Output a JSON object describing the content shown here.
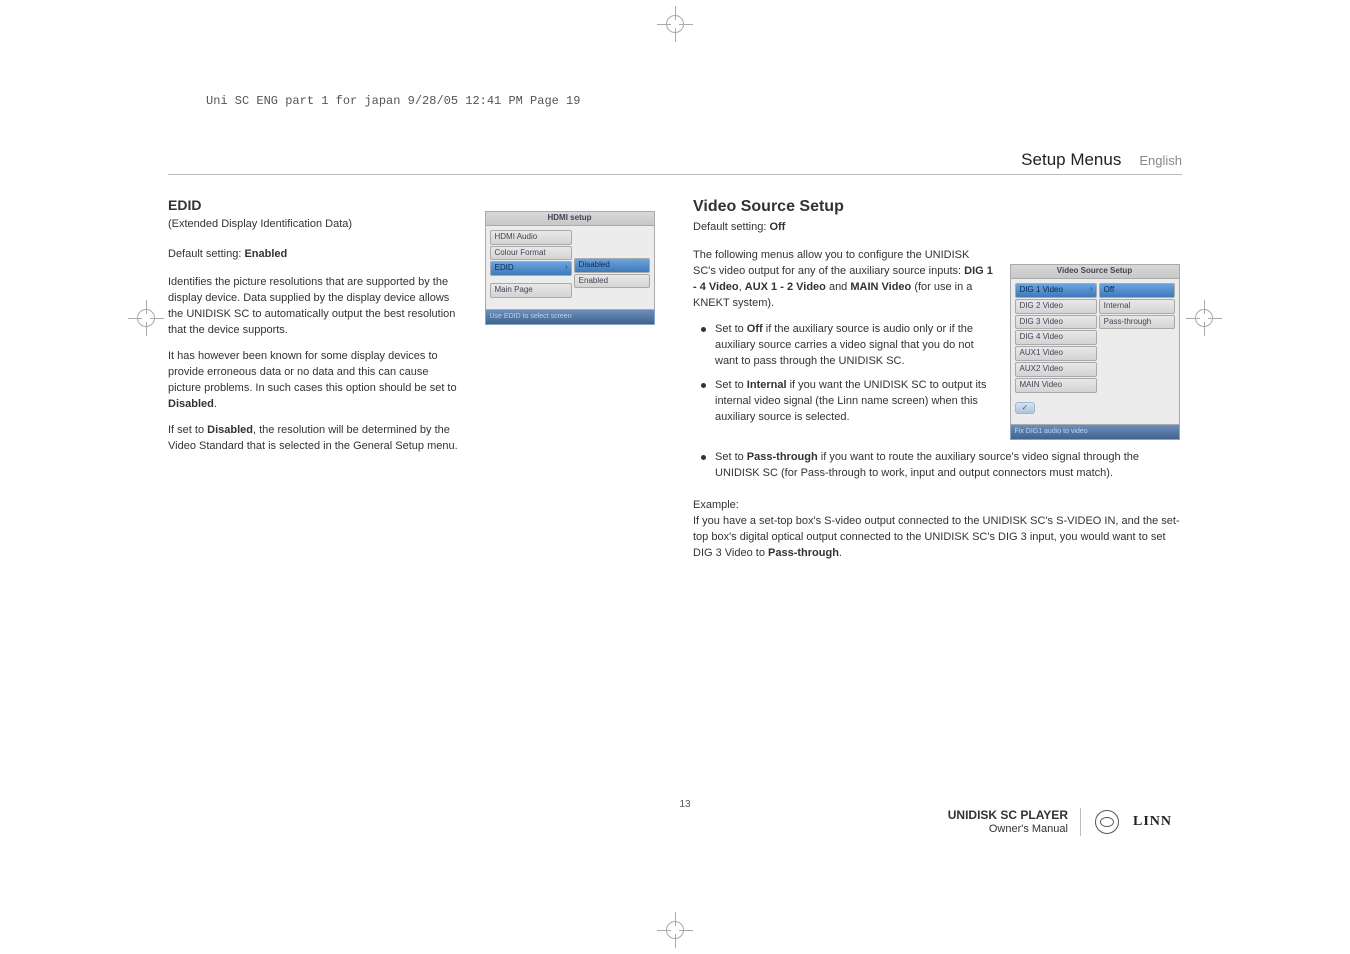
{
  "slug": "Uni SC ENG part 1 for japan  9/28/05  12:41 PM  Page 19",
  "header": {
    "title": "Setup Menus",
    "lang": "English"
  },
  "left": {
    "heading": "EDID",
    "subtitle": "(Extended Display Identification Data)",
    "default": "Default setting: ",
    "default_val": "Enabled",
    "p1": "Identifies the picture resolutions that are supported by the display device. Data supplied by the display device allows the UNIDISK SC to automatically output the best resolution that the device supports.",
    "p2": "It has however been known for some display devices to provide erroneous data or no data and this can cause picture problems. In such cases this option should be set to ",
    "p2b": "Disabled",
    "p2tail": ".",
    "p3a": "If set to ",
    "p3b": "Disabled",
    "p3c": ", the resolution will be determined by the Video Standard that is selected in the General Setup menu."
  },
  "fig1": {
    "title": "HDMI setup",
    "rows": [
      "HDMI Audio",
      "Colour Format",
      "EDID",
      "Main Page"
    ],
    "sel_index": 2,
    "opts": [
      "Disabled",
      "Enabled"
    ],
    "opt_sel": 0,
    "caption": "Use EDID to select screen"
  },
  "right": {
    "heading": "Video Source Setup",
    "default": "Default setting: ",
    "default_val": "Off",
    "p1a": "The following menus allow you to configure the UNIDISK SC's video output for any of the auxiliary source inputs: ",
    "p1b1": "DIG 1 - 4 Video",
    "p1s1": ", ",
    "p1b2": "AUX 1 - 2 Video",
    "p1s2": " and ",
    "p1b3": "MAIN Video",
    "p1c": " (for use in a KNEKT system).",
    "b1a": "Set to ",
    "b1b": "Off",
    "b1c": " if the auxiliary source is audio only or if the auxiliary source carries a video signal that you do not want to pass through the UNIDISK SC.",
    "b2a": "Set to ",
    "b2b": "Internal",
    "b2c": " if you want the UNIDISK SC to output its internal video signal (the Linn name screen) when this auxiliary source is selected.",
    "b3a": "Set to ",
    "b3b": "Pass-through",
    "b3c": "  if you want to route the auxiliary source's video signal through the UNIDISK SC (for Pass-through to work, input and output connectors must match).",
    "example_h": "Example:",
    "example_p": "If you have a set-top box's S-video output connected to the UNIDISK SC's S-VIDEO IN, and the set-top box's digital optical output connected to the UNIDISK SC's DIG 3 input, you would want to set DIG 3 Video to ",
    "example_b": "Pass-through",
    "example_t": "."
  },
  "fig2": {
    "title": "Video Source Setup",
    "rows": [
      "DIG 1 Video",
      "DIG 2 Video",
      "DIG 3 Video",
      "DIG 4 Video",
      "AUX1 Video",
      "AUX2 Video",
      "MAIN Video"
    ],
    "sel_index": 0,
    "opts": [
      "Off",
      "Internal",
      "Pass-through"
    ],
    "opt_sel": 0,
    "tick": "✓",
    "caption": "Fix DIG1 audio to video"
  },
  "chart_data": {
    "type": "table",
    "title": "Setup menu figures depicted in the document page",
    "tables": [
      {
        "name": "HDMI setup",
        "menu_items": [
          "HDMI Audio",
          "Colour Format",
          "EDID",
          "Main Page"
        ],
        "selected_item": "EDID",
        "options": [
          "Disabled",
          "Enabled"
        ],
        "highlighted_option": "Disabled",
        "caption": "Use EDID to select screen"
      },
      {
        "name": "Video Source Setup",
        "menu_items": [
          "DIG 1 Video",
          "DIG 2 Video",
          "DIG 3 Video",
          "DIG 4 Video",
          "AUX1 Video",
          "AUX2 Video",
          "MAIN Video"
        ],
        "selected_item": "DIG 1 Video",
        "options": [
          "Off",
          "Internal",
          "Pass-through"
        ],
        "highlighted_option": "Off",
        "caption": "Fix DIG1 audio to video"
      }
    ]
  },
  "footer": {
    "page_number": "13",
    "product_line1": "UNIDISK SC PLAYER",
    "product_line2": "Owner's Manual",
    "brand": "LINN"
  }
}
